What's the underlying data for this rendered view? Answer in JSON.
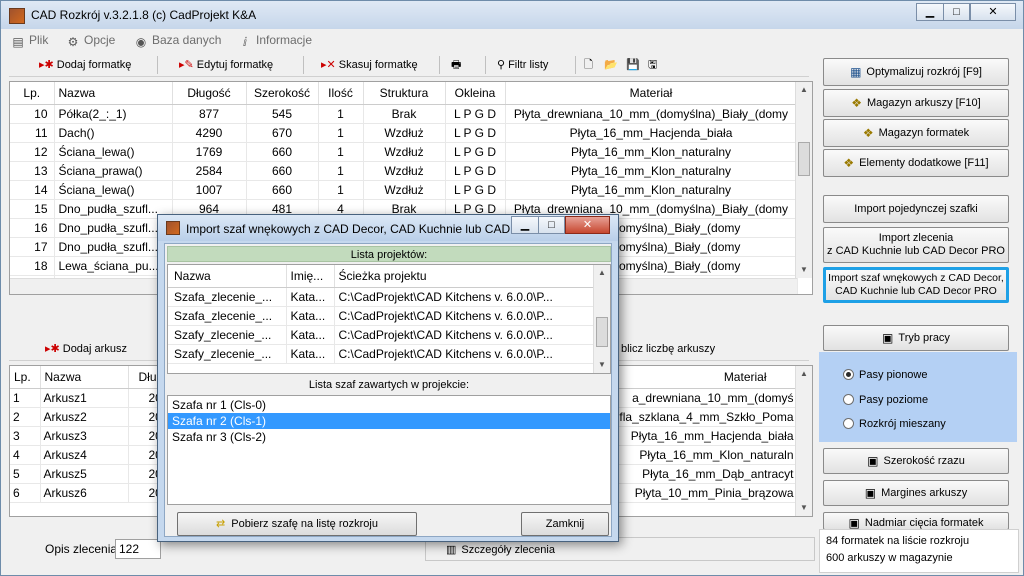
{
  "window": {
    "title": "CAD Rozkrój v.3.2.1.8  (c) CadProjekt K&A"
  },
  "menu": [
    {
      "label": "Plik",
      "icon": "file-icon"
    },
    {
      "label": "Opcje",
      "icon": "options-icon"
    },
    {
      "label": "Baza danych",
      "icon": "database-icon"
    },
    {
      "label": "Informacje",
      "icon": "info-icon"
    }
  ],
  "toolbar": {
    "add_label": "Dodaj formatkę",
    "edit_label": "Edytuj formatkę",
    "delete_label": "Skasuj formatkę",
    "filter_label": "Filtr listy"
  },
  "formatki": {
    "columns": [
      "Lp.",
      "Nazwa",
      "Długość",
      "Szerokość",
      "Ilość",
      "Struktura",
      "Okleina",
      "Materiał"
    ],
    "rows": [
      [
        "10",
        "Półka(2_:_1)",
        "877",
        "545",
        "1",
        "Brak",
        "L P G D",
        "Płyta_drewniana_10_mm_(domyślna)_Biały_(domy"
      ],
      [
        "11",
        "Dach()",
        "4290",
        "670",
        "1",
        "Wzdłuż",
        "L P G D",
        "Płyta_16_mm_Hacjenda_biała"
      ],
      [
        "12",
        "Ściana_lewa()",
        "1769",
        "660",
        "1",
        "Wzdłuż",
        "L P G D",
        "Płyta_16_mm_Klon_naturalny"
      ],
      [
        "13",
        "Ściana_prawa()",
        "2584",
        "660",
        "1",
        "Wzdłuż",
        "L P G D",
        "Płyta_16_mm_Klon_naturalny"
      ],
      [
        "14",
        "Ściana_lewa()",
        "1007",
        "660",
        "1",
        "Wzdłuż",
        "L P G D",
        "Płyta_16_mm_Klon_naturalny"
      ],
      [
        "15",
        "Dno_pudła_szufl...",
        "964",
        "481",
        "4",
        "Brak",
        "L P G D",
        "Płyta_drewniana_10_mm_(domyślna)_Biały_(domy"
      ],
      [
        "16",
        "Dno_pudła_szufl...",
        "",
        "",
        "",
        "",
        "",
        "10_mm_(domyślna)_Biały_(domy"
      ],
      [
        "17",
        "Dno_pudła_szufl...",
        "",
        "",
        "",
        "",
        "",
        "10_mm_(domyślna)_Biały_(domy"
      ],
      [
        "18",
        "Lewa_ściana_pu...",
        "",
        "",
        "",
        "",
        "",
        "10_mm_(domyślna)_Biały_(domy"
      ],
      [
        "19",
        "Prawa_ściana_p...",
        "",
        "",
        "",
        "",
        "",
        "10_mm_(domyślna)_Biały_(domy"
      ]
    ]
  },
  "sheets_toolbar": {
    "add_label": "Dodaj arkusz",
    "count_label": "blicz liczbę arkuszy"
  },
  "arkusze": {
    "columns": [
      "Lp.",
      "Nazwa",
      "Dług",
      "Materiał"
    ],
    "rows": [
      [
        "1",
        "Arkusz1",
        "20",
        "a_drewniana_10_mm_(domyś"
      ],
      [
        "2",
        "Arkusz2",
        "20",
        "fla_szklana_4_mm_Szkło_Poma"
      ],
      [
        "3",
        "Arkusz3",
        "20",
        "Płyta_16_mm_Hacjenda_biała"
      ],
      [
        "4",
        "Arkusz4",
        "20",
        "Płyta_16_mm_Klon_naturaln"
      ],
      [
        "5",
        "Arkusz5",
        "20",
        "Płyta_16_mm_Dąb_antracyt"
      ],
      [
        "6",
        "Arkusz6",
        "20",
        "Płyta_10_mm_Pinia_brązowa"
      ]
    ]
  },
  "order": {
    "label": "Opis zlecenia",
    "value": "122",
    "details_label": "Szczegóły zlecenia"
  },
  "side_buttons": {
    "optimize": "Optymalizuj rozkrój [F9]",
    "sheet_store": "Magazyn arkuszy [F10]",
    "panel_store": "Magazyn formatek",
    "extras": "Elementy dodatkowe [F11]",
    "import_single": "Import pojedynczej szafki",
    "import_order_1": "Import zlecenia",
    "import_order_2": "z CAD Kuchnie lub CAD Decor PRO",
    "import_wardrobe_1": "Import szaf wnękowych z CAD Decor,",
    "import_wardrobe_2": "CAD Kuchnie lub CAD Decor PRO",
    "mode": "Tryb pracy",
    "cut_width": "Szerokość rzazu",
    "margins": "Margines arkuszy",
    "excess": "Nadmiar cięcia formatek"
  },
  "mode_options": [
    {
      "label": "Pasy pionowe",
      "selected": true
    },
    {
      "label": "Pasy poziome",
      "selected": false
    },
    {
      "label": "Rozkrój mieszany",
      "selected": false
    }
  ],
  "status": {
    "line1": "84 formatek na liście rozkroju",
    "line2": "600 arkuszy w magazynie"
  },
  "dialog": {
    "title": "Import szaf wnękowych z CAD Decor, CAD Kuchnie lub CAD...",
    "projects_header": "Lista projektów:",
    "projects_columns": [
      "Nazwa",
      "Imię...",
      "Ścieżka projektu"
    ],
    "projects": [
      [
        "Szafa_zlecenie_...",
        "Kata...",
        "C:\\CadProjekt\\CAD Kitchens v. 6.0.0\\P..."
      ],
      [
        "Szafa_zlecenie_...",
        "Kata...",
        "C:\\CadProjekt\\CAD Kitchens v. 6.0.0\\P..."
      ],
      [
        "Szafy_zlecenie_...",
        "Kata...",
        "C:\\CadProjekt\\CAD Kitchens v. 6.0.0\\P..."
      ],
      [
        "Szafy_zlecenie_...",
        "Kata...",
        "C:\\CadProjekt\\CAD Kitchens v. 6.0.0\\P..."
      ]
    ],
    "wardrobes_header": "Lista szaf zawartych w projekcie:",
    "wardrobes": [
      {
        "label": "Szafa nr 1 (Cls-0)",
        "selected": false
      },
      {
        "label": "Szafa nr 2 (Cls-1)",
        "selected": true
      },
      {
        "label": "Szafa nr 3 (Cls-2)",
        "selected": false
      }
    ],
    "fetch_button": "Pobierz szafę na listę rozkroju",
    "close_button": "Zamknij"
  },
  "colors": {
    "accent": "#1ea0e6",
    "selection": "#3399ff",
    "header_green": "#c2dbbd",
    "mode_panel": "#b4d0f4"
  }
}
